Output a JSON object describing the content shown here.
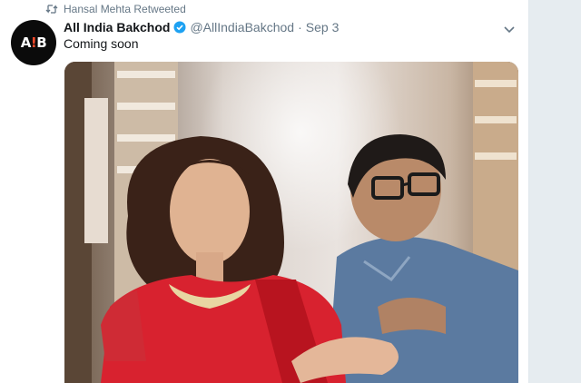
{
  "retweet": {
    "text": "Hansal Mehta Retweeted",
    "icon": "retweet-icon"
  },
  "tweet": {
    "display_name": "All India Bakchod",
    "handle": "@AllIndiaBakchod",
    "separator": "·",
    "date": "Sep 3",
    "text": "Coming soon",
    "avatar_text_a": "A",
    "avatar_text_bang": "!",
    "avatar_text_b": "B",
    "verified_icon": "verified-badge-icon",
    "menu_icon": "chevron-down-icon",
    "media_description": "photo"
  },
  "colors": {
    "verified": "#1da1f2",
    "secondary_text": "#657786",
    "primary_text": "#14171a",
    "avatar_bg": "#0b0b0b",
    "avatar_accent": "#ff4b2b"
  }
}
